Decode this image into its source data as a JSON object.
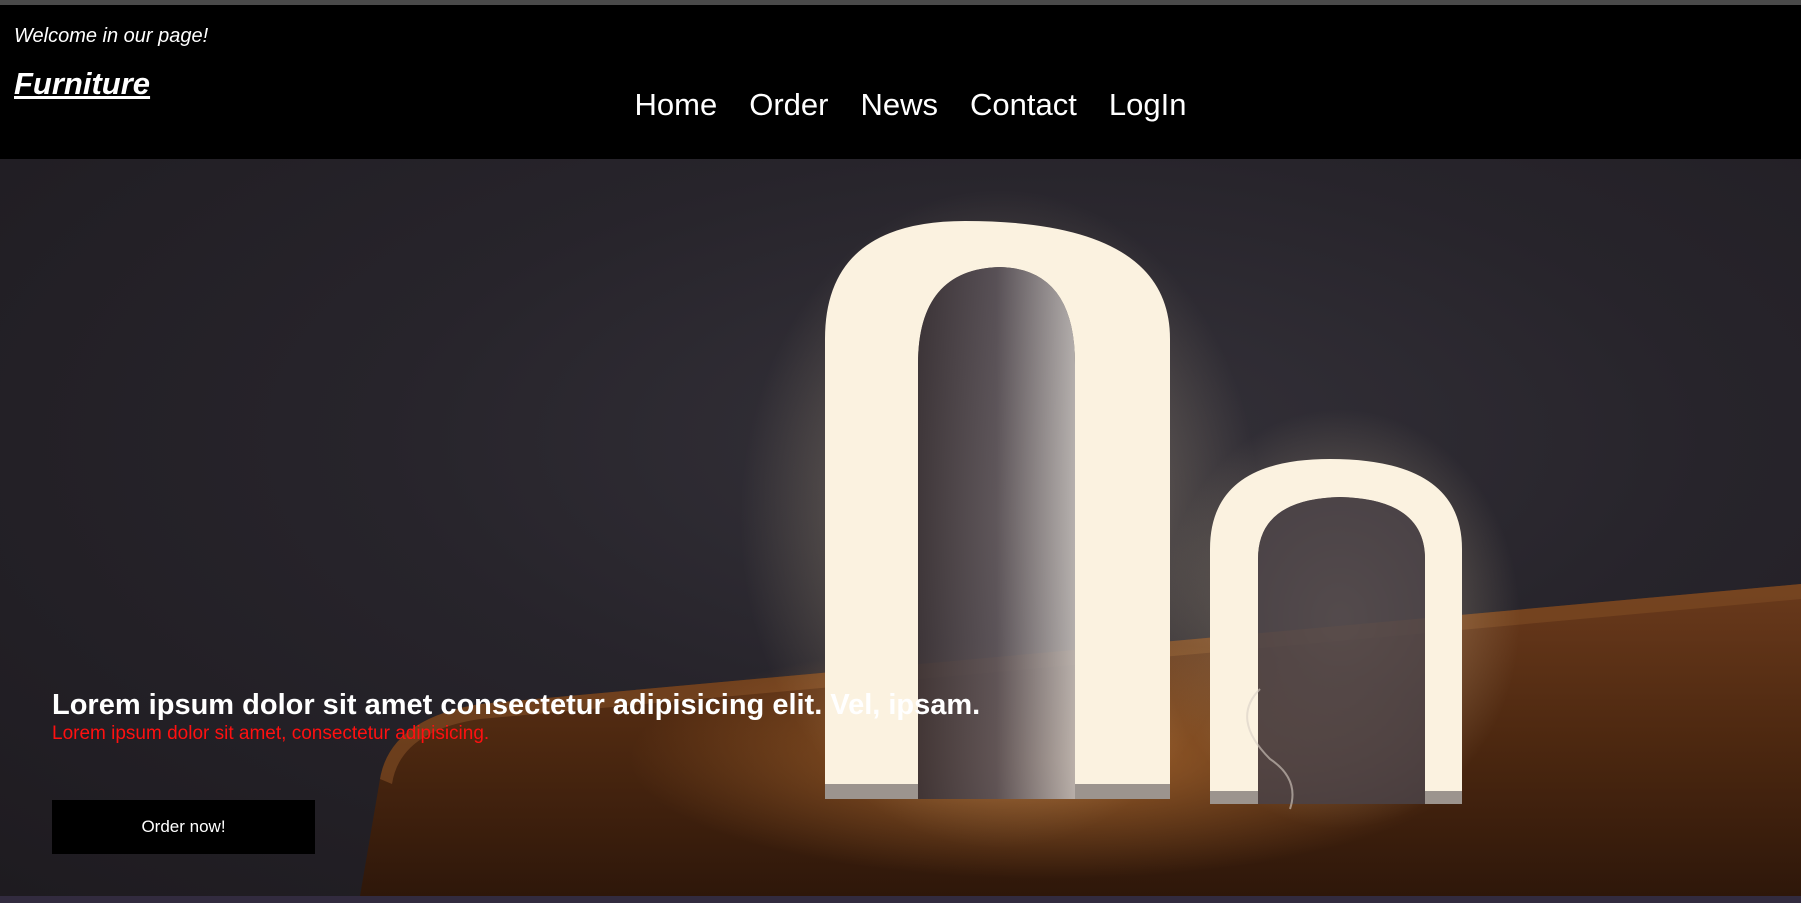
{
  "header": {
    "welcome": "Welcome in our page!",
    "logo": "Furniture"
  },
  "nav": {
    "items": [
      {
        "label": "Home"
      },
      {
        "label": "Order"
      },
      {
        "label": "News"
      },
      {
        "label": "Contact"
      },
      {
        "label": "LogIn"
      }
    ]
  },
  "hero": {
    "title": "Lorem ipsum dolor sit amet consectetur adipisicing elit. Vel, ipsam.",
    "subtitle": "Lorem ipsum dolor sit amet, consectetur adipisicing.",
    "cta_label": "Order now!"
  },
  "colors": {
    "header_bg": "#000000",
    "subtitle": "#ff1010",
    "button_bg": "#000000",
    "lamp_glow": "#fff6e6"
  }
}
